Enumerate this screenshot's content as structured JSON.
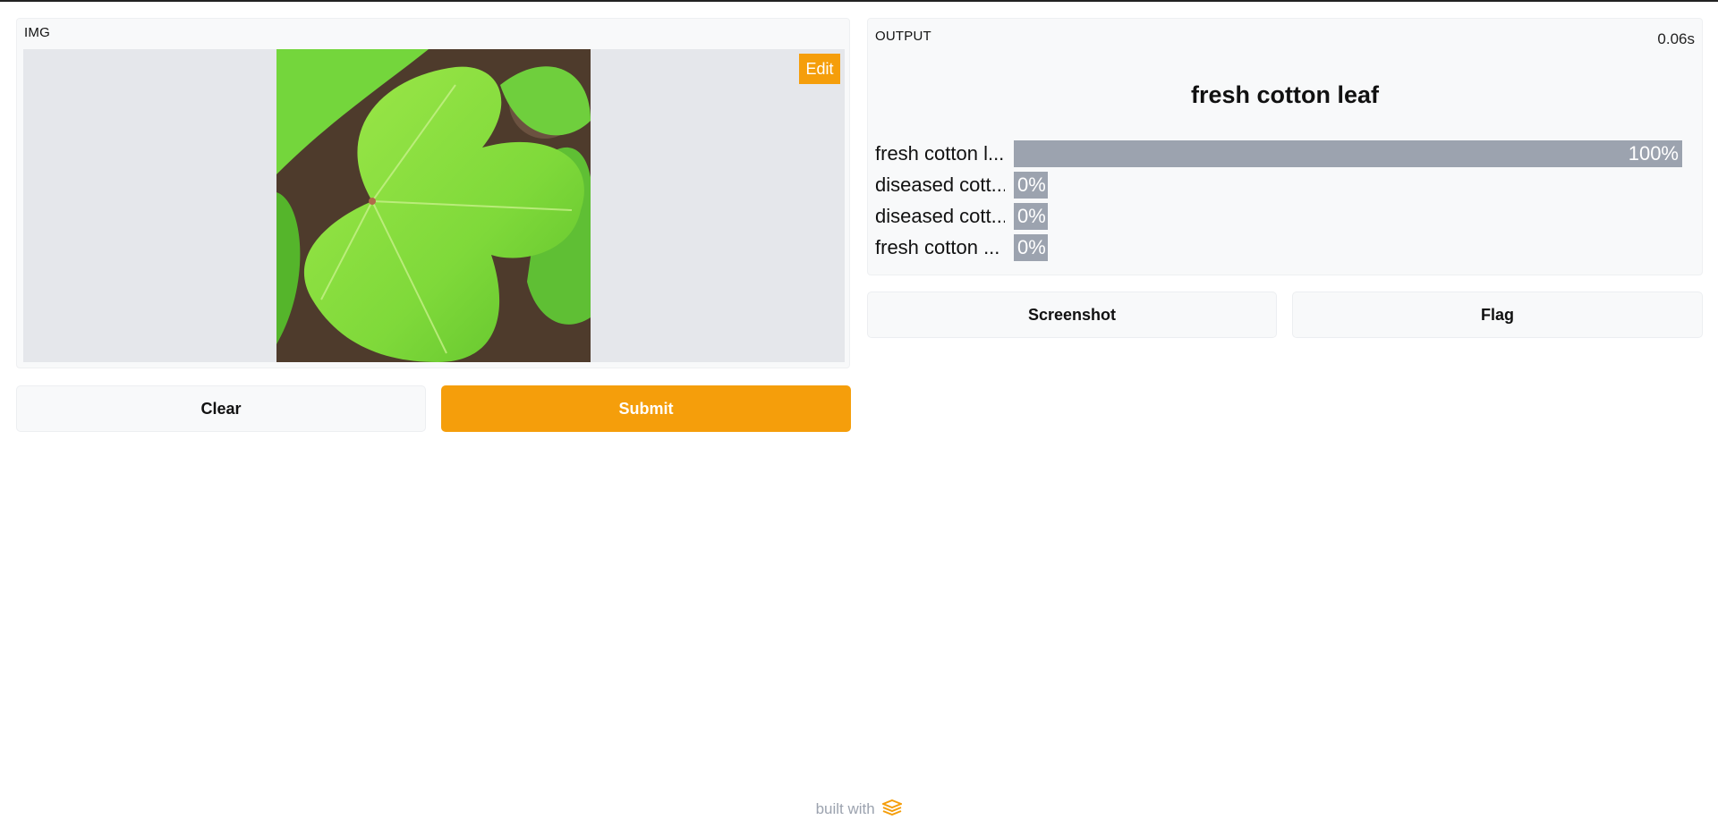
{
  "input": {
    "label": "IMG",
    "edit_label": "Edit"
  },
  "actions": {
    "clear_label": "Clear",
    "submit_label": "Submit"
  },
  "output": {
    "label": "OUTPUT",
    "elapsed": "0.06s",
    "result": "fresh cotton leaf",
    "confidences": [
      {
        "label": "fresh cotton l...",
        "value_text": "100%",
        "value": 1.0
      },
      {
        "label": "diseased cott...",
        "value_text": "0%",
        "value": 0.0
      },
      {
        "label": "diseased cott...",
        "value_text": "0%",
        "value": 0.0
      },
      {
        "label": "fresh cotton ...",
        "value_text": "0%",
        "value": 0.0
      }
    ]
  },
  "output_actions": {
    "screenshot_label": "Screenshot",
    "flag_label": "Flag"
  },
  "footer": {
    "text": "built with"
  },
  "colors": {
    "accent": "#f59e0b",
    "bar": "#9ca3af",
    "panel": "#f8f9fa"
  }
}
